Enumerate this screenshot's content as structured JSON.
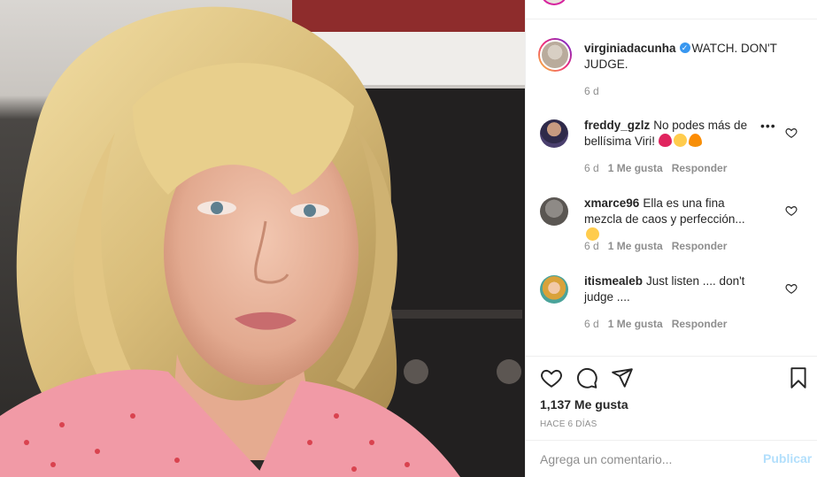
{
  "post": {
    "author": "virginiadacunha",
    "caption": "WATCH. DON'T JUDGE.",
    "age": "6 d",
    "verified_icon": "verified-badge-icon"
  },
  "comments": [
    {
      "user": "freddy_gzlz",
      "text": "No podes más de bellísima Viri!",
      "emoji": [
        "heart",
        "star-struck",
        "fire"
      ],
      "age": "6 d",
      "likes": "1 Me gusta",
      "reply": "Responder"
    },
    {
      "user": "xmarce96",
      "text": "Ella es una fina mezcla de caos y perfección...",
      "emoji": [
        "smiling-face"
      ],
      "age": "6 d",
      "likes": "1 Me gusta",
      "reply": "Responder"
    },
    {
      "user": "itismealeb",
      "text": "Just listen .... don't judge ....",
      "emoji": [],
      "age": "6 d",
      "likes": "1 Me gusta",
      "reply": "Responder"
    }
  ],
  "actions": {
    "like_icon": "heart-icon",
    "comment_icon": "comment-icon",
    "share_icon": "paper-plane-icon",
    "save_icon": "bookmark-icon",
    "likes_count": "1,137 Me gusta",
    "time_ago": "HACE 6 DÍAS"
  },
  "add_comment": {
    "placeholder": "Agrega un comentario...",
    "publish_label": "Publicar"
  },
  "colors": {
    "verified": "#3897f0",
    "muted": "#8e8e8e",
    "publish_disabled": "#b2dffc",
    "divider": "#efefef"
  }
}
